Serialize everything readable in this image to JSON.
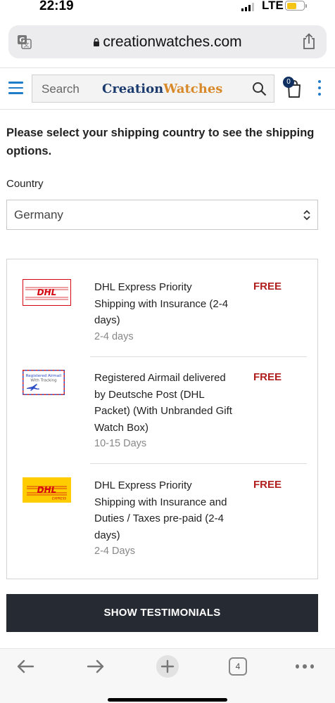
{
  "status_bar": {
    "time": "22:19",
    "network": "LTE"
  },
  "browser": {
    "url": "creationwatches.com",
    "open_tabs": "4"
  },
  "site_header": {
    "search_placeholder": "Search",
    "brand_part1": "Creation",
    "brand_part2": "Watches",
    "cart_count": "0"
  },
  "shipping": {
    "prompt": "Please select your shipping country to see the shipping options.",
    "country_label": "Country",
    "country_value": "Germany",
    "options": [
      {
        "logo": "dhl-logo-white",
        "name": "DHL Express Priority Shipping with Insurance (2-4 days)",
        "days": "2-4 days",
        "price": "FREE"
      },
      {
        "logo": "registered-airmail-logo",
        "name": "Registered Airmail delivered by Deutsche Post (DHL Packet) (With Unbranded Gift Watch Box)",
        "days": "10-15 Days",
        "price": "FREE"
      },
      {
        "logo": "dhl-express-logo-yellow",
        "name": "DHL Express Priority Shipping with Insurance and Duties / Taxes pre-paid (2-4 days)",
        "days": "2-4 Days",
        "price": "FREE"
      }
    ],
    "logo_text": {
      "dhl": "DHL",
      "airmail_line1": "Registered Airmail",
      "airmail_line2": "With Tracking",
      "express": "EXPRESS"
    }
  },
  "testimonials_button": "SHOW TESTIMONIALS",
  "colors": {
    "accent_blue": "#1f7cc8",
    "brand_navy": "#1b3a6d",
    "brand_orange": "#d8892a",
    "price_red": "#b01e1e",
    "dhl_red": "#d40511",
    "dhl_yellow": "#ffcc00",
    "button_dark": "#262a33"
  },
  "icons": [
    "translate-icon",
    "lock-icon",
    "share-icon",
    "menu-icon",
    "search-icon",
    "cart-icon",
    "kebab-menu-icon",
    "select-arrows-icon",
    "back-arrow-icon",
    "forward-arrow-icon",
    "new-tab-icon",
    "tabs-icon",
    "more-icon"
  ]
}
